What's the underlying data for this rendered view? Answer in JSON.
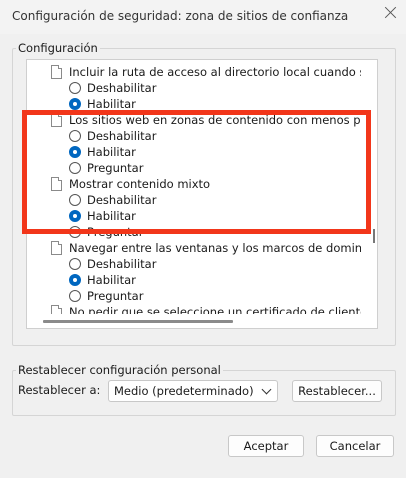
{
  "window": {
    "title": "Configuración de seguridad: zona de sitios de confianza"
  },
  "settings_group": {
    "label": "Configuración",
    "items": [
      {
        "label": "Incluir la ruta de acceso al directorio local cuando se carguen",
        "options": [
          {
            "label": "Deshabilitar",
            "selected": false
          },
          {
            "label": "Habilitar",
            "selected": true
          }
        ]
      },
      {
        "label": "Los sitios web en zonas de contenido con menos privilegios p",
        "options": [
          {
            "label": "Deshabilitar",
            "selected": false
          },
          {
            "label": "Habilitar",
            "selected": true
          },
          {
            "label": "Preguntar",
            "selected": false
          }
        ]
      },
      {
        "label": "Mostrar contenido mixto",
        "options": [
          {
            "label": "Deshabilitar",
            "selected": false
          },
          {
            "label": "Habilitar",
            "selected": true
          },
          {
            "label": "Preguntar",
            "selected": false
          }
        ]
      },
      {
        "label": "Navegar entre las ventanas y los marcos de dominios distint",
        "options": [
          {
            "label": "Deshabilitar",
            "selected": false
          },
          {
            "label": "Habilitar",
            "selected": true
          },
          {
            "label": "Preguntar",
            "selected": false
          }
        ]
      },
      {
        "label": "No pedir que se seleccione un certificado de cliente cuando e",
        "options": []
      }
    ]
  },
  "reset_group": {
    "label": "Restablecer configuración personal",
    "reset_to_label": "Restablecer a:",
    "selected_level": "Medio (predeterminado)",
    "reset_button": "Restablecer..."
  },
  "footer": {
    "ok_button": "Aceptar",
    "cancel_button": "Cancelar"
  },
  "colors": {
    "highlight_border": "#f2361a",
    "radio_selected": "#0067c0"
  }
}
